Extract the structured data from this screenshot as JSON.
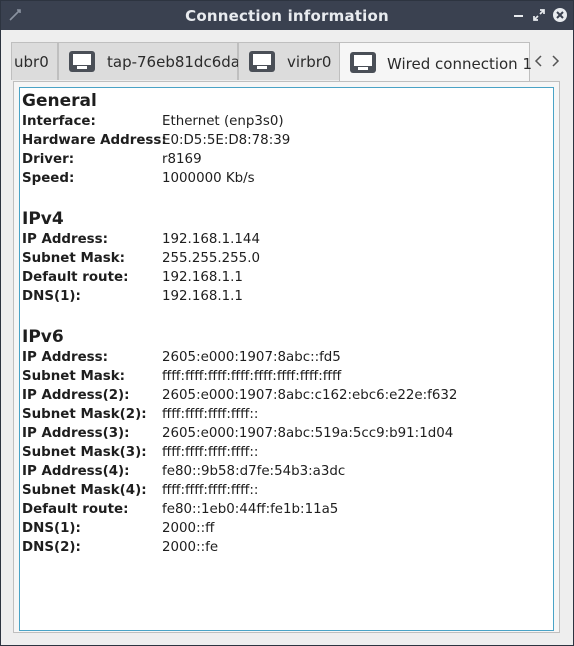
{
  "window": {
    "title": "Connection information"
  },
  "tabs": [
    {
      "label": "ubr0",
      "active": false,
      "has_icon": false
    },
    {
      "label": "tap-76eb81dc6da",
      "active": false,
      "has_icon": true
    },
    {
      "label": "virbr0",
      "active": false,
      "has_icon": true
    },
    {
      "label": "Wired connection 1",
      "active": true,
      "has_icon": true
    }
  ],
  "sections": {
    "general": {
      "title": "General",
      "rows": [
        {
          "key": "Interface:",
          "value": "Ethernet (enp3s0)"
        },
        {
          "key": "Hardware Address:",
          "value": "E0:D5:5E:D8:78:39"
        },
        {
          "key": "Driver:",
          "value": "r8169"
        },
        {
          "key": "Speed:",
          "value": "1000000 Kb/s"
        }
      ]
    },
    "ipv4": {
      "title": "IPv4",
      "rows": [
        {
          "key": "IP Address:",
          "value": "192.168.1.144"
        },
        {
          "key": "Subnet Mask:",
          "value": "255.255.255.0"
        },
        {
          "key": "Default route:",
          "value": "192.168.1.1"
        },
        {
          "key": "DNS(1):",
          "value": "192.168.1.1"
        }
      ]
    },
    "ipv6": {
      "title": "IPv6",
      "rows": [
        {
          "key": "IP Address:",
          "value": "2605:e000:1907:8abc::fd5"
        },
        {
          "key": "Subnet Mask:",
          "value": "ffff:ffff:ffff:ffff:ffff:ffff:ffff:ffff"
        },
        {
          "key": "IP Address(2):",
          "value": "2605:e000:1907:8abc:c162:ebc6:e22e:f632"
        },
        {
          "key": "Subnet Mask(2):",
          "value": "ffff:ffff:ffff:ffff::"
        },
        {
          "key": "IP Address(3):",
          "value": "2605:e000:1907:8abc:519a:5cc9:b91:1d04"
        },
        {
          "key": "Subnet Mask(3):",
          "value": "ffff:ffff:ffff:ffff::"
        },
        {
          "key": "IP Address(4):",
          "value": "fe80::9b58:d7fe:54b3:a3dc"
        },
        {
          "key": "Subnet Mask(4):",
          "value": "ffff:ffff:ffff:ffff::"
        },
        {
          "key": "Default route:",
          "value": "fe80::1eb0:44ff:fe1b:11a5"
        },
        {
          "key": "DNS(1):",
          "value": "2000::ff"
        },
        {
          "key": "DNS(2):",
          "value": "2000::fe"
        }
      ]
    }
  },
  "icons": {
    "app": "network-app-icon",
    "minimize": "minimize-icon",
    "maximize": "maximize-icon",
    "close": "close-icon",
    "tab": "monitor-icon",
    "scroll_left": "chevron-left-icon",
    "scroll_right": "chevron-right-icon"
  },
  "colors": {
    "titlebar": "#3a4150",
    "title_text": "#e8ebef",
    "focus_border": "#4aa3c6"
  }
}
